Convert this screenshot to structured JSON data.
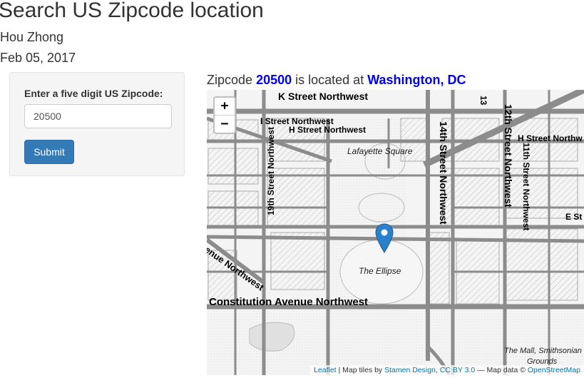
{
  "page": {
    "title": "Search US Zipcode location",
    "author": "Hou Zhong",
    "date": "Feb 05, 2017"
  },
  "form": {
    "label": "Enter a five digit US Zipcode:",
    "zip_value": "20500",
    "submit_label": "Submit"
  },
  "result": {
    "prefix": "Zipcode",
    "zipcode": "20500",
    "middle": "is located at",
    "location": "Washington, DC",
    "highlight_color": "#0000ee"
  },
  "map": {
    "zoom_in": "+",
    "zoom_out": "−",
    "marker_icon": "map-pin-icon",
    "marker_color": "#2a81cb",
    "street_labels": {
      "k_street": "K Street Northwest",
      "i_street": "I Street Northwest",
      "h_street": "H Street Northwest",
      "h_street_east": "H Street Northw",
      "street_19th": "19th Street Northwest",
      "street_14th": "14th Street Northwest",
      "street_12th": "12th Street Northwest",
      "street_11th": "11th Street Northwest",
      "street_13": "13",
      "e_street": "E St",
      "avenue_nw": "enue Northwest",
      "constitution": "Constitution Avenue Northwest"
    },
    "place_labels": {
      "lafayette": "Lafayette Square",
      "ellipse": "The Ellipse",
      "mall_line1": "The Mall, Smithsonian",
      "mall_line2": "Grounds"
    },
    "attribution": {
      "leaflet": "Leaflet",
      "sep1": " | Map tiles by ",
      "stamen": "Stamen Design",
      "comma": ", ",
      "license": "CC BY 3.0",
      "sep2": " — Map data © ",
      "osm": "OpenStreetMap"
    }
  }
}
